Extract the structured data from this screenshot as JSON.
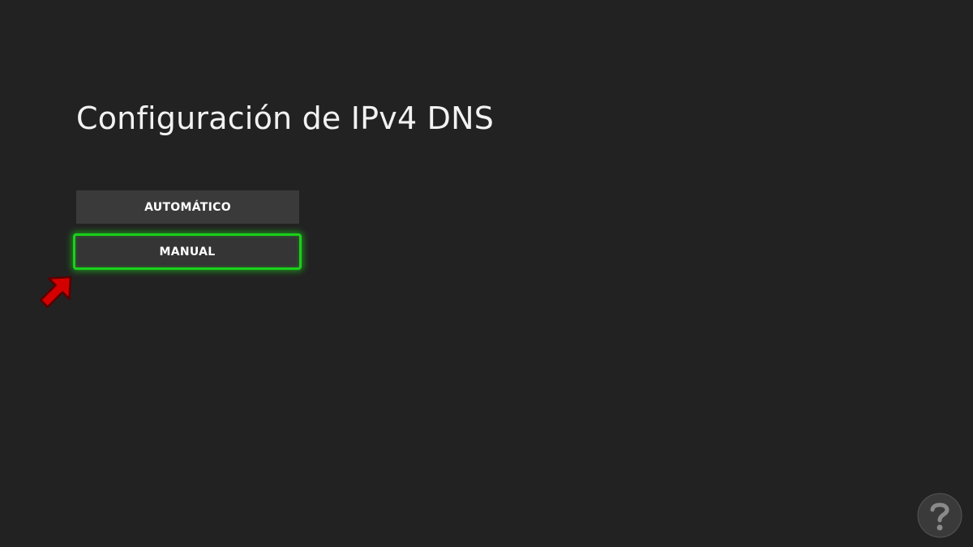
{
  "title": "Configuración de IPv4 DNS",
  "options": [
    {
      "label": "AUTOMÁTICO",
      "selected": false
    },
    {
      "label": "MANUAL",
      "selected": true
    }
  ],
  "colors": {
    "background": "#222222",
    "option_bg": "#3a3a3a",
    "focus_outline": "#19d119",
    "annotation_arrow": "#d40000"
  },
  "icons": {
    "annotation": "red-arrow-icon",
    "watermark": "solvetic-logo-icon"
  }
}
